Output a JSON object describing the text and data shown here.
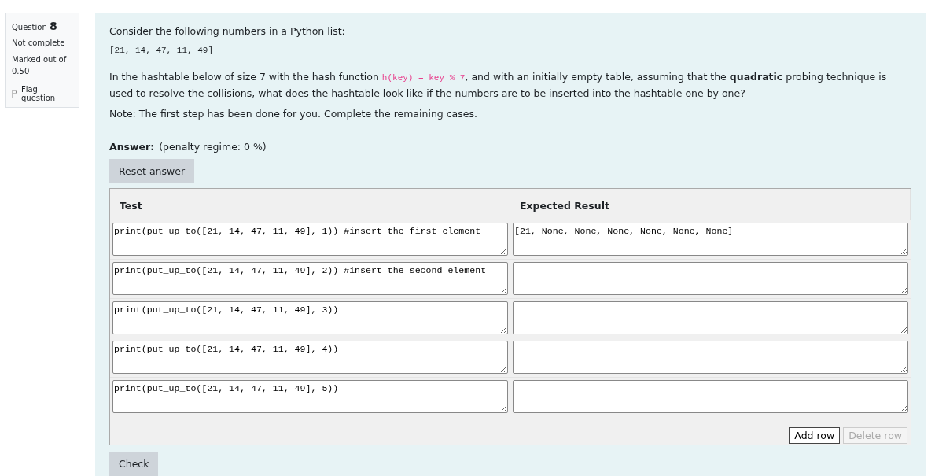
{
  "info": {
    "question_label": "Question",
    "question_number": "8",
    "status": "Not complete",
    "marked_out_of": "Marked out of",
    "mark": "0.50",
    "flag": {
      "label": "Flag question",
      "flagged": false
    }
  },
  "question": {
    "intro": "Consider the following numbers in a Python list:",
    "list_code": "[21, 14, 47, 11, 49]",
    "paragraph": {
      "before": "In the hashtable below of size 7 with the hash function ",
      "code": "h(key) = key % 7",
      "after": ", and with an initially empty table, assuming that the **quadratic** probing technique is used to resolve the collisions, what does the hashtable look like if the numbers are to be inserted into the hashtable one by one?"
    },
    "note": "Note: The first step has been done for you. Complete the remaining cases."
  },
  "answer": {
    "label": "Answer:",
    "penalty": "(penalty regime: 0 %)",
    "reset_button": "Reset answer"
  },
  "table": {
    "columns": [
      "Test",
      "Expected Result"
    ],
    "rows": [
      {
        "test": "print(put_up_to([21, 14, 47, 11, 49], 1)) #insert the first element",
        "expected": "[21, None, None, None, None, None, None]"
      },
      {
        "test": "print(put_up_to([21, 14, 47, 11, 49], 2)) #insert the second element"
      },
      {
        "test": "print(put_up_to([21, 14, 47, 11, 49], 3))"
      },
      {
        "test": "print(put_up_to([21, 14, 47, 11, 49], 4))"
      },
      {
        "test": "print(put_up_to([21, 14, 47, 11, 49], 5))"
      }
    ],
    "buttons": [
      {
        "label": "Add row",
        "disabled": false
      },
      {
        "label": "Delete row",
        "disabled": true
      }
    ]
  },
  "check_button": "Check"
}
